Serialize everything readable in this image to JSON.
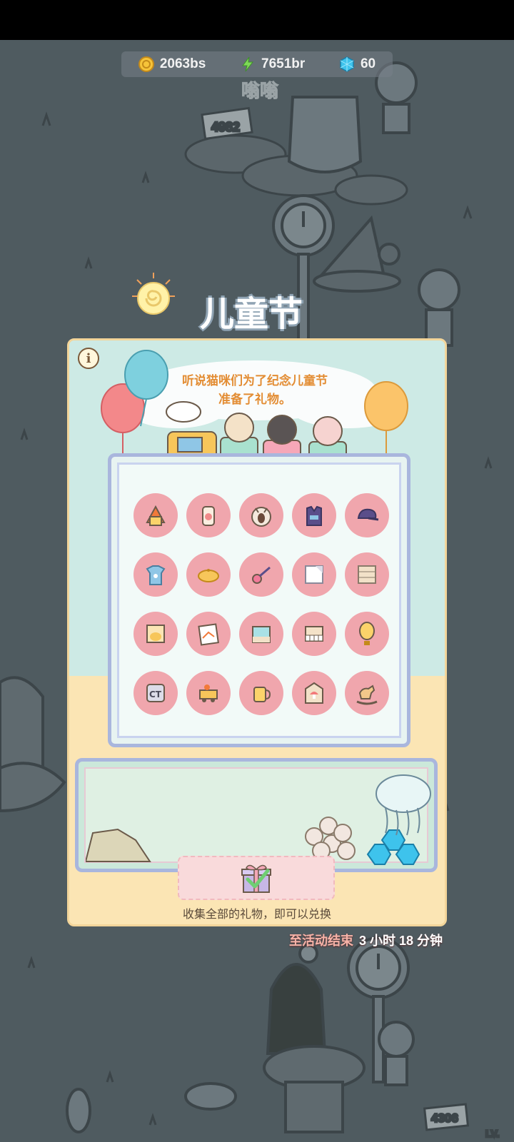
{
  "currency": {
    "coins": "2063bs",
    "energy": "7651br",
    "gems": "60"
  },
  "background": {
    "sign_top": "4982",
    "sign_bottom": "4306",
    "sound_text": "嗡嗡",
    "lv_tag": "LV."
  },
  "event": {
    "title": "儿童节",
    "description_line1": "听说猫咪们为了纪念儿童节",
    "description_line2": "准备了礼物。",
    "hint": "收集全部的礼物，即可以兑换",
    "countdown_label": "至活动结束",
    "countdown_value": "3 小时 18 分钟"
  },
  "gifts": [
    {
      "icon": "house-lamp-icon"
    },
    {
      "icon": "toy-vase-icon"
    },
    {
      "icon": "cat-mask-icon"
    },
    {
      "icon": "vest-icon"
    },
    {
      "icon": "cap-icon"
    },
    {
      "icon": "shirt-icon"
    },
    {
      "icon": "beret-icon"
    },
    {
      "icon": "lollipop-icon"
    },
    {
      "icon": "paper-tile-icon"
    },
    {
      "icon": "wood-panel-icon"
    },
    {
      "icon": "cat-frame-icon"
    },
    {
      "icon": "drawing-board-icon"
    },
    {
      "icon": "aquarium-icon"
    },
    {
      "icon": "piano-icon"
    },
    {
      "icon": "hot-air-balloon-icon"
    },
    {
      "icon": "ct-tile-icon"
    },
    {
      "icon": "toy-truck-icon"
    },
    {
      "icon": "mug-icon"
    },
    {
      "icon": "mushroom-frame-icon"
    },
    {
      "icon": "rocking-horse-icon"
    }
  ],
  "colors": {
    "panel": "#fbe5b4",
    "gift_bg": "#f0a6ad",
    "board_border": "#a9b6dd",
    "title_text": "#ffffff",
    "desc_text": "#e38d34"
  }
}
